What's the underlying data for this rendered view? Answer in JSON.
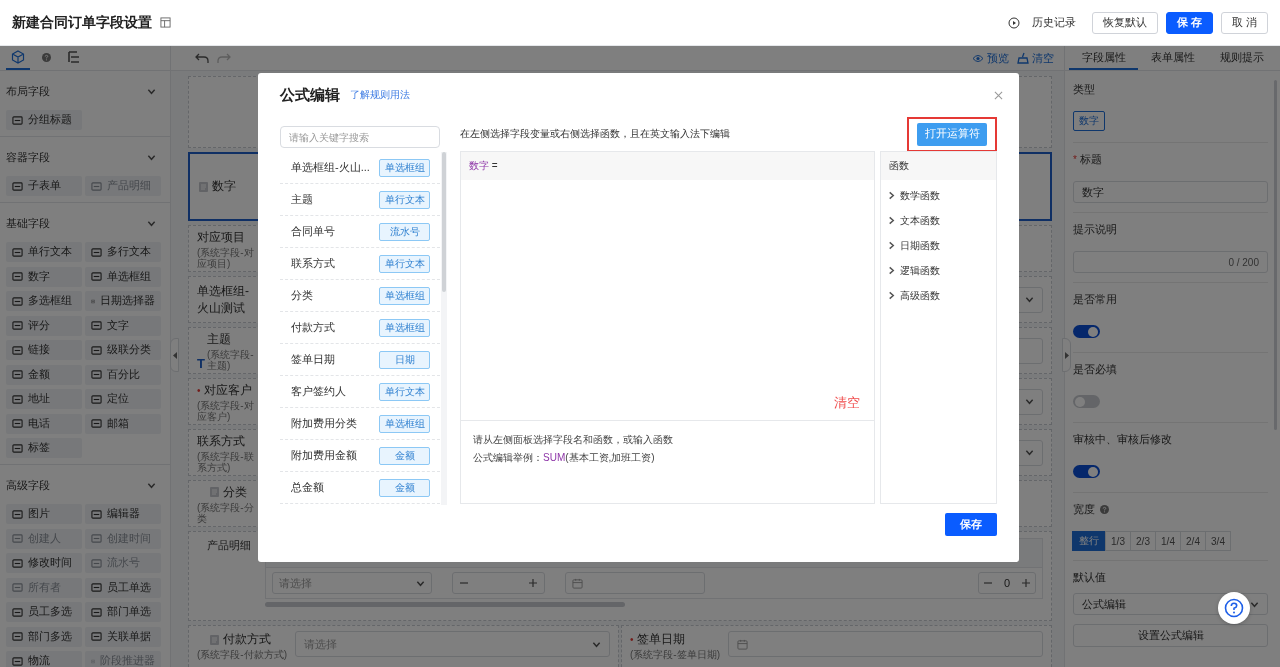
{
  "header": {
    "title": "新建合同订单字段设置",
    "history": "历史记录",
    "buttons": [
      {
        "label": "恢复默认",
        "primary": false
      },
      {
        "label": "保 存",
        "primary": true
      },
      {
        "label": "取 消",
        "primary": false
      }
    ]
  },
  "palette": {
    "tabs": [
      {
        "kind": "cube",
        "selected": true
      },
      {
        "kind": "help",
        "selected": false
      },
      {
        "kind": "tree",
        "selected": false
      }
    ],
    "sections": [
      {
        "title": "布局字段",
        "items": [
          {
            "label": "分组标题",
            "disabled": false
          }
        ]
      },
      {
        "title": "容器字段",
        "items": [
          {
            "label": "子表单",
            "disabled": false
          },
          {
            "label": "产品明细",
            "disabled": true
          }
        ]
      },
      {
        "title": "基础字段",
        "items": [
          {
            "label": "单行文本",
            "disabled": false
          },
          {
            "label": "多行文本",
            "disabled": false
          },
          {
            "label": "数字",
            "disabled": false
          },
          {
            "label": "单选框组",
            "disabled": false
          },
          {
            "label": "多选框组",
            "disabled": false
          },
          {
            "label": "日期选择器",
            "disabled": false
          },
          {
            "label": "评分",
            "disabled": false
          },
          {
            "label": "文字",
            "disabled": false
          },
          {
            "label": "链接",
            "disabled": false
          },
          {
            "label": "级联分类",
            "disabled": false
          },
          {
            "label": "金额",
            "disabled": false
          },
          {
            "label": "百分比",
            "disabled": false
          },
          {
            "label": "地址",
            "disabled": false
          },
          {
            "label": "定位",
            "disabled": false
          },
          {
            "label": "电话",
            "disabled": false
          },
          {
            "label": "邮箱",
            "disabled": false
          },
          {
            "label": "标签",
            "disabled": false
          }
        ]
      },
      {
        "title": "高级字段",
        "items": [
          {
            "label": "图片",
            "disabled": false
          },
          {
            "label": "编辑器",
            "disabled": false
          },
          {
            "label": "创建人",
            "disabled": true
          },
          {
            "label": "创建时间",
            "disabled": true
          },
          {
            "label": "修改时间",
            "disabled": false
          },
          {
            "label": "流水号",
            "disabled": true
          },
          {
            "label": "所有者",
            "disabled": true
          },
          {
            "label": "员工单选",
            "disabled": false
          },
          {
            "label": "员工多选",
            "disabled": false
          },
          {
            "label": "部门单选",
            "disabled": false
          },
          {
            "label": "部门多选",
            "disabled": false
          },
          {
            "label": "关联单据",
            "disabled": false
          },
          {
            "label": "物流",
            "disabled": false
          },
          {
            "label": "阶段推进器",
            "disabled": true
          }
        ]
      }
    ]
  },
  "canvas": {
    "toolbar": {
      "preview": "预览",
      "clear": "清空"
    },
    "cards": [
      {
        "kind": "blank",
        "selected": false,
        "full_row": true
      },
      {
        "kind": "icon-field",
        "selected": true,
        "full_row": true,
        "label": "数字"
      },
      {
        "kind": "field",
        "selected": false,
        "full_row": true,
        "label": "对应项目",
        "sublabel": "(系统字段-对应项目)"
      },
      {
        "kind": "field",
        "selected": false,
        "full_row": true,
        "label": "单选框组-火山测试",
        "control": {
          "kind": "select"
        }
      },
      {
        "kind": "text-field",
        "selected": false,
        "full_row": true,
        "marker": "T",
        "label": "主题",
        "sublabel": "(系统字段-主题)",
        "control": {
          "kind": "input"
        }
      },
      {
        "kind": "field",
        "selected": false,
        "full_row": true,
        "required_mark": "•",
        "label": "对应客户",
        "sublabel": "(系统字段-对应客户)",
        "control": {
          "kind": "select"
        }
      },
      {
        "kind": "field",
        "selected": false,
        "full_row": true,
        "label": "联系方式",
        "sublabel": "(系统字段-联系方式)",
        "control": {
          "kind": "select"
        }
      },
      {
        "kind": "icon-field",
        "selected": false,
        "full_row": true,
        "label": "分类",
        "sublabel": "(系统字段-分类"
      },
      {
        "kind": "table",
        "selected": false,
        "full_row": true,
        "label": "产品明细",
        "cells": [
          {
            "kind": "select",
            "placeholder": "请选择"
          },
          {
            "kind": "stepper"
          },
          {
            "kind": "date"
          },
          {
            "kind": "stepper",
            "value": "0"
          }
        ]
      },
      {
        "kind": "icon-field",
        "selected": false,
        "full_row": false,
        "label": "付款方式",
        "sublabel": "(系统字段-付款方式)",
        "control": {
          "kind": "select",
          "placeholder": "请选择"
        }
      },
      {
        "kind": "field",
        "selected": false,
        "full_row": false,
        "required_mark": "•",
        "label": "签单日期",
        "sublabel": "(系统字段-签单日期)",
        "control": {
          "kind": "date"
        }
      }
    ]
  },
  "properties": {
    "tabs": [
      {
        "label": "字段属性",
        "selected": true
      },
      {
        "label": "表单属性",
        "selected": false
      },
      {
        "label": "规则提示",
        "selected": false
      }
    ],
    "type_label": "类型",
    "type_tag": "数字",
    "title_required_mark": "*",
    "title_label": "标题",
    "title_value": "数字",
    "hint_label": "提示说明",
    "hint_counter": "0 / 200",
    "toggles": [
      {
        "label": "是否常用",
        "on": true
      },
      {
        "label": "是否必填",
        "on": false
      },
      {
        "label": "审核中、审核后修改",
        "on": true
      }
    ],
    "width_label": "宽度",
    "width_options": [
      {
        "label": "整行",
        "selected": true
      },
      {
        "label": "1/3",
        "selected": false
      },
      {
        "label": "2/3",
        "selected": false
      },
      {
        "label": "1/4",
        "selected": false
      },
      {
        "label": "2/4",
        "selected": false
      },
      {
        "label": "3/4",
        "selected": false
      }
    ],
    "default_label": "默认值",
    "default_value": "公式编辑",
    "formula_button": "设置公式编辑"
  },
  "modal": {
    "title": "公式编辑",
    "help_link": "了解规则用法",
    "search_placeholder": "请输入关键字搜索",
    "fields": [
      {
        "name": "单选框组-火山...",
        "type": "单选框组"
      },
      {
        "name": "主题",
        "type": "单行文本"
      },
      {
        "name": "合同单号",
        "type": "流水号"
      },
      {
        "name": "联系方式",
        "type": "单行文本"
      },
      {
        "name": "分类",
        "type": "单选框组"
      },
      {
        "name": "付款方式",
        "type": "单选框组"
      },
      {
        "name": "签单日期",
        "type": "日期"
      },
      {
        "name": "客户签约人",
        "type": "单行文本"
      },
      {
        "name": "附加费用分类",
        "type": "单选框组"
      },
      {
        "name": "附加费用金额",
        "type": "金额"
      },
      {
        "name": "总金额",
        "type": "金额"
      }
    ],
    "instruction": "在左侧选择字段变量或右侧选择函数，且在英文输入法下编辑",
    "operator_button": "打开运算符",
    "operator_highlighted": true,
    "formula": {
      "field": "数字",
      "operator": "="
    },
    "clear": "清空",
    "hint": {
      "line": "请从左侧面板选择字段名和函数，或输入函数",
      "example_label": "公式编辑举例：",
      "example_function": "SUM",
      "example_args": "(基本工资,加班工资)"
    },
    "functions_title": "函数",
    "function_groups": [
      {
        "label": "数学函数"
      },
      {
        "label": "文本函数"
      },
      {
        "label": "日期函数"
      },
      {
        "label": "逻辑函数"
      },
      {
        "label": "高级函数"
      }
    ],
    "save": "保存"
  }
}
